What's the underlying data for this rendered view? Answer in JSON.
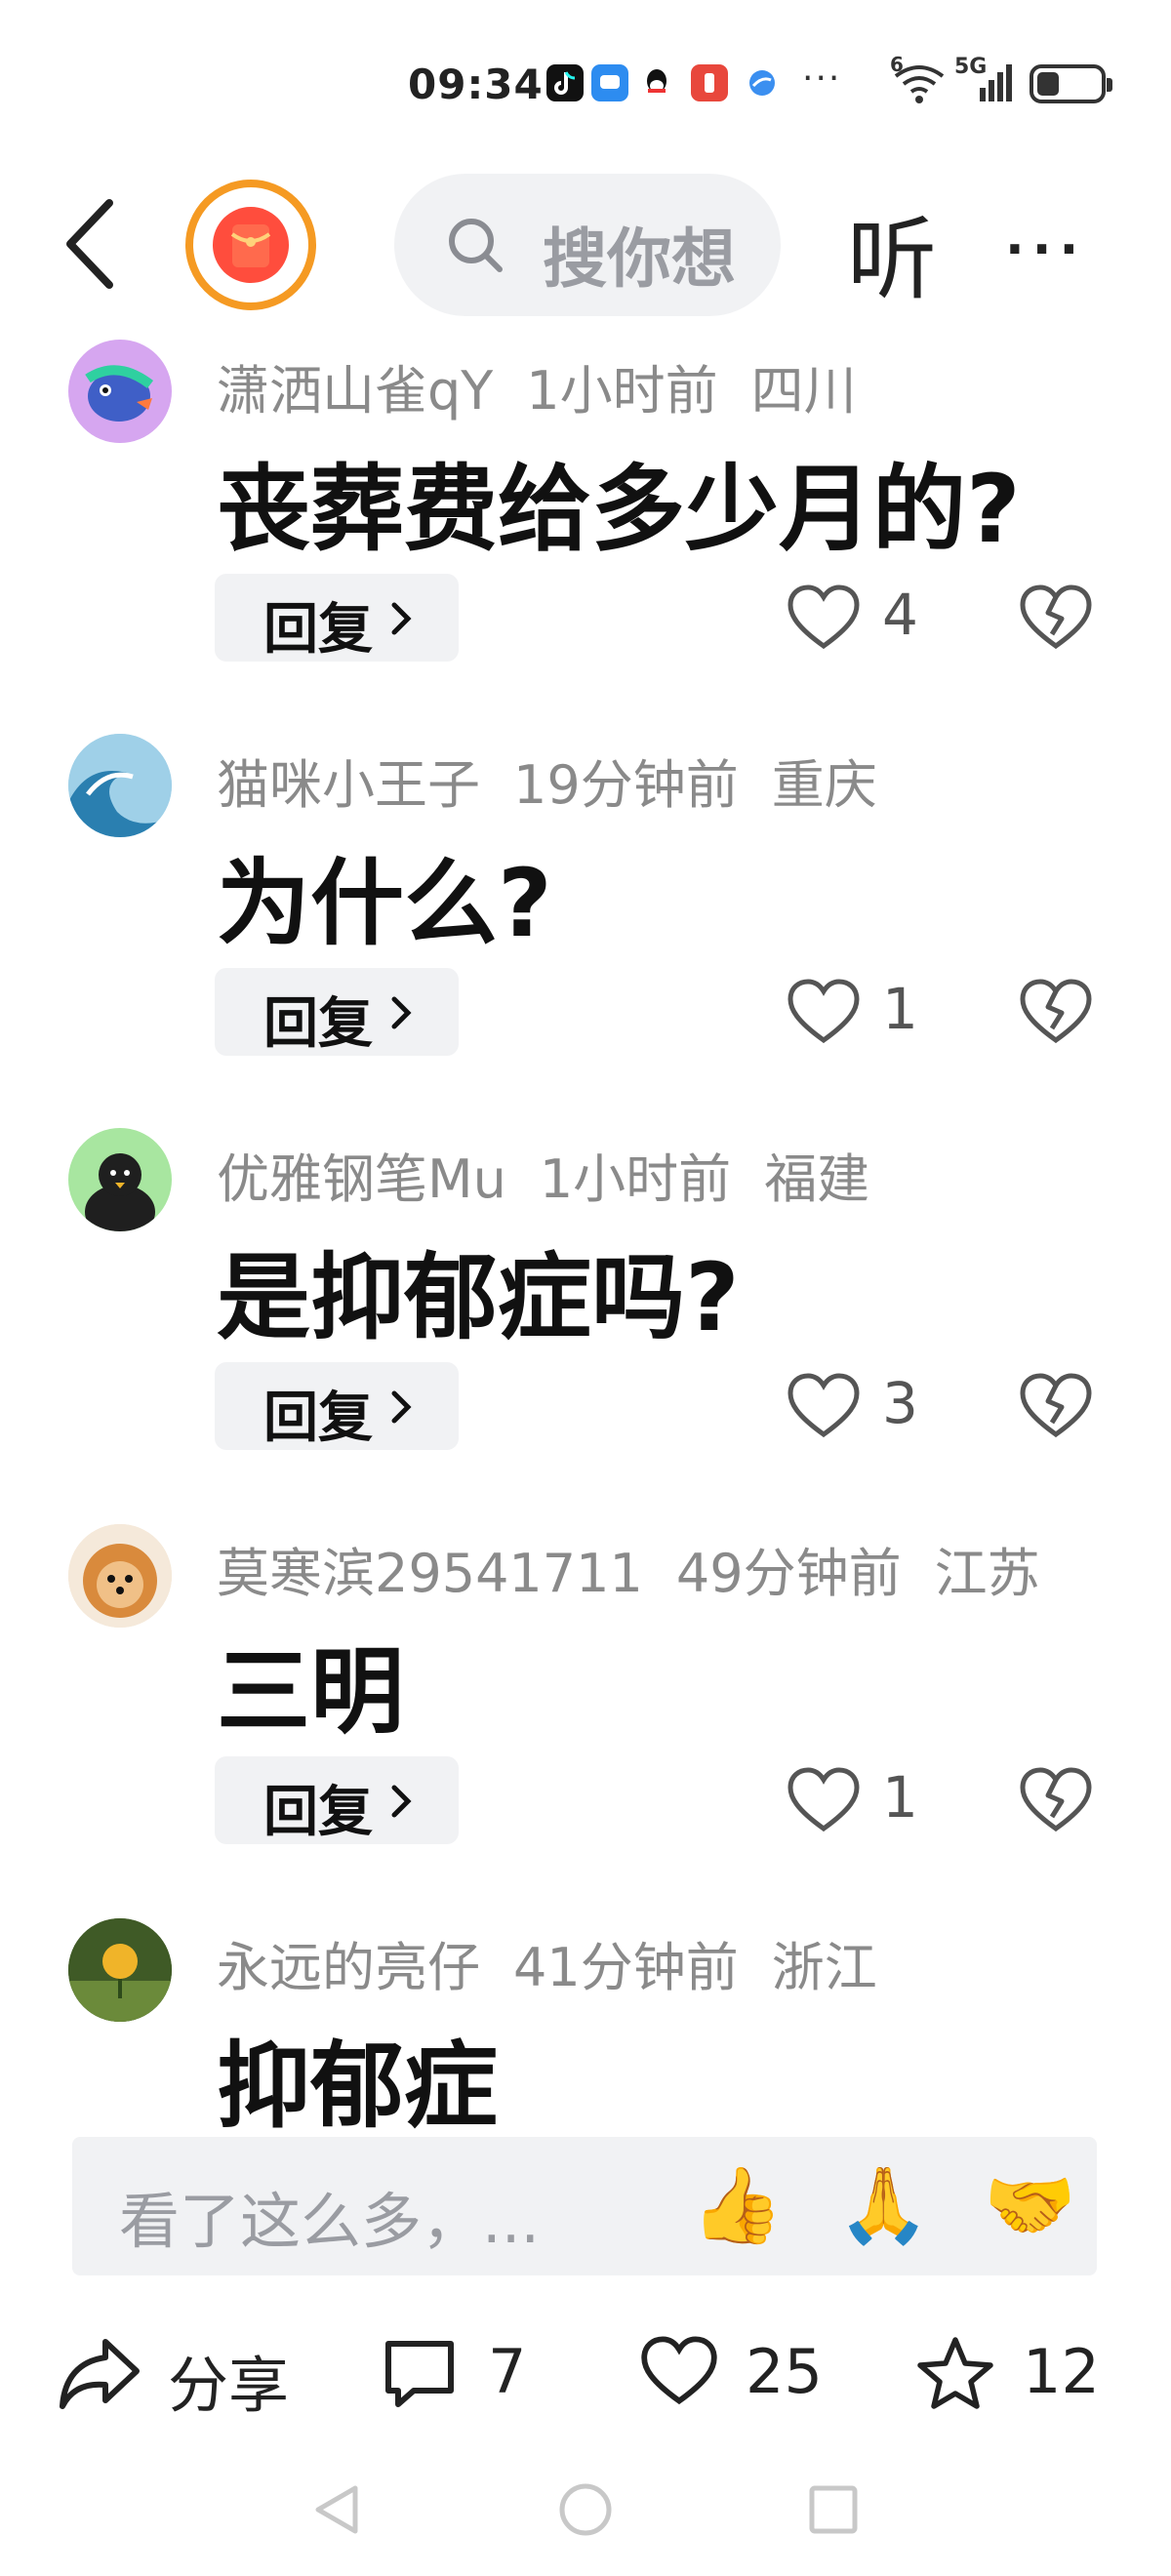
{
  "status_bar": {
    "time": "09:34",
    "notification_dots": "···",
    "wifi_sup": "6",
    "cell_label": "5G",
    "battery_level_fraction": 0.35
  },
  "nav": {
    "back_icon": "chevron-left-icon",
    "red_packet_icon": "red-envelope-icon",
    "search_placeholder": "搜你想",
    "listen_label": "听",
    "more_label": "···"
  },
  "comments": [
    {
      "user": "潇洒山雀qY",
      "time": "1小时前",
      "region": "四川",
      "text": "丧葬费给多少月的?",
      "reply_label": "回复",
      "likes": "4"
    },
    {
      "user": "猫咪小王子",
      "time": "19分钟前",
      "region": "重庆",
      "text": "为什么?",
      "reply_label": "回复",
      "likes": "1"
    },
    {
      "user": "优雅钢笔Mu",
      "time": "1小时前",
      "region": "福建",
      "text": "是抑郁症吗?",
      "reply_label": "回复",
      "likes": "3"
    },
    {
      "user": "莫寒滨29541711",
      "time": "49分钟前",
      "region": "江苏",
      "text": "三明",
      "reply_label": "回复",
      "likes": "1"
    },
    {
      "user": "永远的亮仔",
      "time": "41分钟前",
      "region": "浙江",
      "text": "抑郁症"
    }
  ],
  "input_bar": {
    "placeholder": "看了这么多，...",
    "emoji_1": "👍",
    "emoji_2": "🙏",
    "emoji_3": "🤝"
  },
  "actions": {
    "share_label": "分享",
    "comment_count": "7",
    "like_count": "25",
    "favorite_count": "12"
  },
  "colors": {
    "accent_orange": "#f59a23",
    "red_packet": "#ff4d3d",
    "meta_gray": "#8a8a8a",
    "pill_bg": "#f1f2f4"
  }
}
